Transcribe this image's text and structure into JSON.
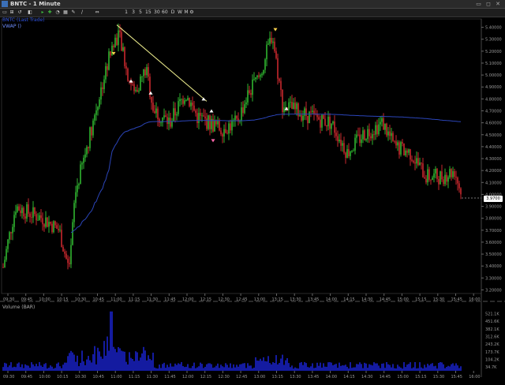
{
  "window": {
    "title": "BNTC - 1 Minute",
    "buttons": "▭ ◻ ✕"
  },
  "toolbar": {
    "items": [
      {
        "label": "▭",
        "name": "layout-icon"
      },
      {
        "label": "⊞",
        "name": "grid-icon"
      },
      {
        "label": "↺",
        "name": "refresh-icon"
      },
      {
        "label": "◧",
        "name": "split-icon"
      },
      {
        "label": "▸",
        "name": "forward-icon"
      },
      {
        "label": "✚",
        "name": "crosshair-icon"
      },
      {
        "label": "◔",
        "name": "chart-type-icon"
      },
      {
        "label": "▦",
        "name": "bar-chart-icon"
      },
      {
        "label": "✎",
        "name": "draw-icon"
      },
      {
        "label": "/",
        "name": "trendline-icon"
      },
      {
        "label": "⇔",
        "name": "scroll-icon"
      },
      {
        "label": "1",
        "name": "interval-1-button"
      },
      {
        "label": "3",
        "name": "interval-3-button"
      },
      {
        "label": "5",
        "name": "interval-5-button"
      },
      {
        "label": "15",
        "name": "interval-15-button"
      },
      {
        "label": "30",
        "name": "interval-30-button"
      },
      {
        "label": "60",
        "name": "interval-60-button"
      },
      {
        "label": "D",
        "name": "interval-d-button"
      },
      {
        "label": "W",
        "name": "interval-w-button"
      },
      {
        "label": "M",
        "name": "interval-m-button"
      },
      {
        "label": "⚙",
        "name": "settings-icon"
      }
    ]
  },
  "legend": {
    "study1": "BNTC (Last Trade)",
    "study2": "VWAP ()",
    "volume": "Volume (BAR)"
  },
  "colors": {
    "up": "#2fb52f",
    "down": "#c8282e",
    "vwap": "#2b45b9",
    "volume": "#1a22c8",
    "trend": "#e8e88a",
    "axis": "#9a9a9a"
  },
  "last_price": "3.9700",
  "chart_data": {
    "type": "candlestick",
    "price_ticks": [
      "5.40000",
      "5.30000",
      "5.20000",
      "5.10000",
      "5.00000",
      "4.90000",
      "4.80000",
      "4.70000",
      "4.60000",
      "4.50000",
      "4.40000",
      "4.30000",
      "4.20000",
      "4.10000",
      "4.00000",
      "3.90000",
      "3.80000",
      "3.70000",
      "3.60000",
      "3.50000",
      "3.40000",
      "3.30000",
      "3.20000"
    ],
    "time_ticks": [
      "09:30",
      "09:45",
      "10:00",
      "10:15",
      "10:30",
      "10:45",
      "11:00",
      "11:15",
      "11:30",
      "11:45",
      "12:00",
      "12:15",
      "12:30",
      "12:45",
      "13:00",
      "13:15",
      "13:30",
      "13:45",
      "14:00",
      "14:15",
      "14:30",
      "14:45",
      "15:00",
      "15:15",
      "15:30",
      "15:45",
      "16:00"
    ],
    "volume_ticks": [
      "521.1K",
      "451.6K",
      "382.1K",
      "312.6K",
      "243.2K",
      "173.7K",
      "104.2K",
      "34.7K"
    ],
    "price_ylim": [
      3.17,
      5.47
    ],
    "volume_ylim": [
      0,
      560000
    ]
  }
}
